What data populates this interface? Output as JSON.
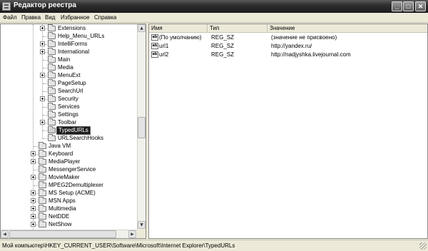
{
  "window": {
    "title": "Редактор реестра",
    "controls": {
      "minimize": "_",
      "maximize": "□",
      "close": "✕"
    }
  },
  "menu": [
    "Файл",
    "Правка",
    "Вид",
    "Избранное",
    "Справка"
  ],
  "tree": {
    "items": [
      {
        "label": "Extensions",
        "level": 2,
        "expandable": true
      },
      {
        "label": "Help_Menu_URLs",
        "level": 2,
        "expandable": false
      },
      {
        "label": "IntelliForms",
        "level": 2,
        "expandable": true
      },
      {
        "label": "International",
        "level": 2,
        "expandable": true
      },
      {
        "label": "Main",
        "level": 2,
        "expandable": false
      },
      {
        "label": "Media",
        "level": 2,
        "expandable": false
      },
      {
        "label": "MenuExt",
        "level": 2,
        "expandable": true
      },
      {
        "label": "PageSetup",
        "level": 2,
        "expandable": false
      },
      {
        "label": "SearchUrl",
        "level": 2,
        "expandable": false
      },
      {
        "label": "Security",
        "level": 2,
        "expandable": true
      },
      {
        "label": "Services",
        "level": 2,
        "expandable": false
      },
      {
        "label": "Settings",
        "level": 2,
        "expandable": false
      },
      {
        "label": "Toolbar",
        "level": 2,
        "expandable": true
      },
      {
        "label": "TypedURLs",
        "level": 2,
        "expandable": false,
        "selected": true
      },
      {
        "label": "URLSearchHooks",
        "level": 2,
        "expandable": false
      },
      {
        "label": "Java VM",
        "level": 1,
        "expandable": false
      },
      {
        "label": "Keyboard",
        "level": 1,
        "expandable": true
      },
      {
        "label": "MediaPlayer",
        "level": 1,
        "expandable": true
      },
      {
        "label": "MessengerService",
        "level": 1,
        "expandable": false
      },
      {
        "label": "MovieMaker",
        "level": 1,
        "expandable": true
      },
      {
        "label": "MPEG2Demultiplexer",
        "level": 1,
        "expandable": false
      },
      {
        "label": "MS Setup (ACME)",
        "level": 1,
        "expandable": true
      },
      {
        "label": "MSN Apps",
        "level": 1,
        "expandable": true
      },
      {
        "label": "Multimedia",
        "level": 1,
        "expandable": true
      },
      {
        "label": "NetDDE",
        "level": 1,
        "expandable": true
      },
      {
        "label": "NetShow",
        "level": 1,
        "expandable": true
      }
    ]
  },
  "list": {
    "columns": [
      "Имя",
      "Тип",
      "Значение"
    ],
    "icon_text": "ab",
    "rows": [
      {
        "name": "(По умолчанию)",
        "type": "REG_SZ",
        "value": "(значение не присвоено)"
      },
      {
        "name": "url1",
        "type": "REG_SZ",
        "value": "http://yandex.ru/"
      },
      {
        "name": "url2",
        "type": "REG_SZ",
        "value": "http://nadjyshka.livejournal.com"
      }
    ]
  },
  "scroll": {
    "up": "▲",
    "down": "▼",
    "left": "◀",
    "right": "▶"
  },
  "status": {
    "path": "Мой компьютер\\HKEY_CURRENT_USER\\Software\\Microsoft\\Internet Explorer\\TypedURLs"
  }
}
